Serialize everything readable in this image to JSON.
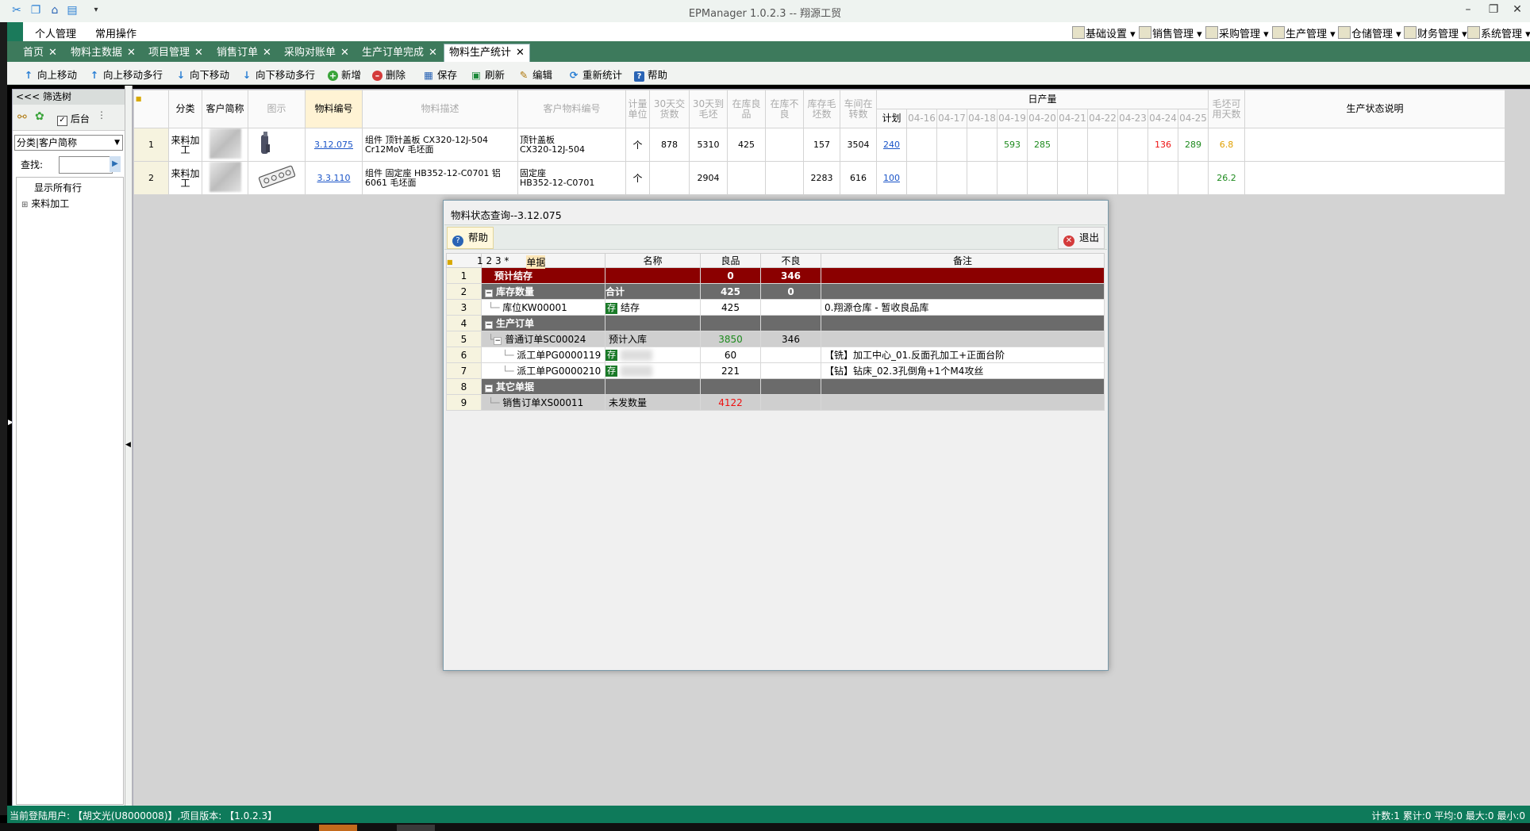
{
  "app": {
    "title": "EPManager 1.0.2.3 -- 翔源工贸",
    "quick_access_icons": [
      "tools-icon",
      "windows-icon",
      "home-icon",
      "folder-icon",
      "dropdown-icon"
    ]
  },
  "menubar": {
    "left": [
      "个人管理",
      "常用操作"
    ],
    "right": [
      "基础设置",
      "销售管理",
      "采购管理",
      "生产管理",
      "仓储管理",
      "财务管理",
      "系统管理"
    ]
  },
  "tabs": [
    {
      "label": "首页"
    },
    {
      "label": "物料主数据"
    },
    {
      "label": "项目管理"
    },
    {
      "label": "销售订单"
    },
    {
      "label": "采购对账单"
    },
    {
      "label": "生产订单完成"
    },
    {
      "label": "物料生产统计",
      "active": true
    }
  ],
  "toolbar": {
    "buttons": [
      "向上移动",
      "向上移动多行",
      "向下移动",
      "向下移动多行",
      "新增",
      "删除",
      "保存",
      "刷新",
      "编辑",
      "重新统计",
      "帮助"
    ]
  },
  "filter": {
    "title": "<<< 筛选树",
    "checkbox_label": "后台",
    "combo_value": "分类|客户简称",
    "search_label": "查找:",
    "tree": [
      "显示所有行",
      "来料加工"
    ]
  },
  "grid": {
    "headers": {
      "category": "分类",
      "customer": "客户简称",
      "image": "图示",
      "code": "物料编号",
      "desc": "物料描述",
      "cust_code": "客户物料编号",
      "unit": "计量单位",
      "h30_delivery": "30天交货数",
      "h30_blank": "30天到毛坯",
      "good_stock": "在库良品",
      "bad_stock": "在库不良",
      "blank_stock": "库存毛坯数",
      "wip": "车间在转数",
      "daily": "日产量",
      "plan": "计划",
      "days": [
        "04-16",
        "04-17",
        "04-18",
        "04-19",
        "04-20",
        "04-21",
        "04-22",
        "04-23",
        "04-24",
        "04-25"
      ],
      "blank_days": "毛坯可用天数",
      "status": "生产状态说明"
    },
    "rows": [
      {
        "n": "1",
        "category": "来料加工",
        "code": "3.12.075",
        "desc1": "组件 顶针盖板 CX320-12J-504",
        "desc2": "Cr12MoV 毛坯面",
        "cust1": "顶针盖板",
        "cust2": "CX320-12J-504",
        "unit": "个",
        "d30": "878",
        "b30": "5310",
        "good": "425",
        "bad": "",
        "blank": "157",
        "wip": "3504",
        "plan": "240",
        "days": [
          "",
          "",
          "",
          "593",
          "285",
          "",
          "",
          "",
          "136",
          "289"
        ],
        "blank_days": "6.8",
        "status": ""
      },
      {
        "n": "2",
        "category": "来料加工",
        "code": "3.3.110",
        "desc1": "组件 固定座 HB352-12-C0701 铝",
        "desc2": "6061 毛坯面",
        "cust1": "固定座",
        "cust2": "HB352-12-C0701",
        "unit": "个",
        "d30": "",
        "b30": "2904",
        "good": "",
        "bad": "",
        "blank": "2283",
        "wip": "616",
        "plan": "100",
        "days": [
          "",
          "",
          "",
          "",
          "",
          "",
          "",
          "",
          "",
          ""
        ],
        "blank_days": "26.2",
        "status": ""
      }
    ]
  },
  "dialog": {
    "title": "物料状态查询--3.12.075",
    "help_label": "帮助",
    "exit_label": "退出",
    "levels": [
      "1",
      "2",
      "3",
      "*"
    ],
    "headers": {
      "doc": "单据",
      "name": "名称",
      "good": "良品",
      "bad": "不良",
      "remark": "备注"
    },
    "rows": [
      {
        "n": "1",
        "doc": "预计结存",
        "name": "",
        "good": "0",
        "bad": "346",
        "remark": ""
      },
      {
        "n": "2",
        "doc": "库存数量",
        "name": "合计",
        "good": "425",
        "bad": "0",
        "remark": ""
      },
      {
        "n": "3",
        "doc": "库位KW00001",
        "tag": "存",
        "name": "结存",
        "good": "425",
        "bad": "",
        "remark": "0.翔源仓库 - 暂收良品库"
      },
      {
        "n": "4",
        "doc": "生产订单",
        "name": "",
        "good": "",
        "bad": "",
        "remark": ""
      },
      {
        "n": "5",
        "doc": "普通订单SC00024",
        "name": "预计入库",
        "good": "3850",
        "bad": "346",
        "remark": ""
      },
      {
        "n": "6",
        "doc": "派工单PG0000119",
        "tag": "存",
        "name": "",
        "good": "60",
        "bad": "",
        "remark": "【铣】加工中心_01.反面孔加工+正面台阶"
      },
      {
        "n": "7",
        "doc": "派工单PG0000210",
        "tag": "存",
        "name": "",
        "good": "221",
        "bad": "",
        "remark": "【钻】钻床_02.3孔倒角+1个M4攻丝"
      },
      {
        "n": "8",
        "doc": "其它单据",
        "name": "",
        "good": "",
        "bad": "",
        "remark": ""
      },
      {
        "n": "9",
        "doc": "销售订单XS00011",
        "name": "未发数量",
        "good": "4122",
        "bad": "",
        "remark": ""
      }
    ]
  },
  "status": {
    "left": "当前登陆用户: 【胡文光(U8000008)】,项目版本: 【1.0.2.3】",
    "right": "计数:1 累计:0 平均:0 最大:0 最小:0"
  },
  "colors": {
    "brand_green": "#3d7a5c",
    "status_green": "#0e7a5a",
    "dialog_red_row": "#8b0000"
  }
}
